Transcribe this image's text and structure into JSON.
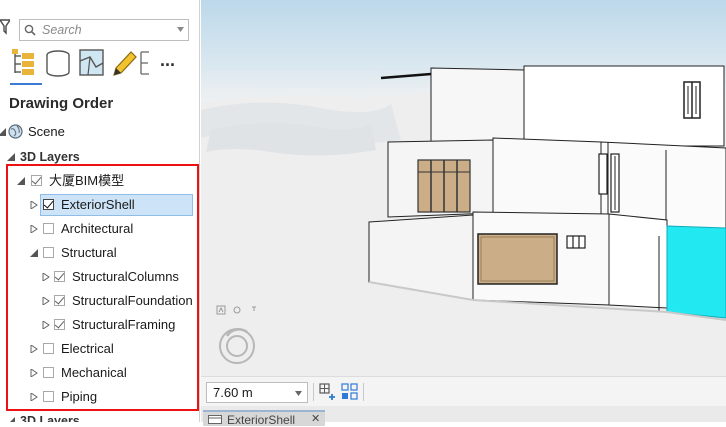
{
  "search": {
    "placeholder": "Search"
  },
  "contents": {
    "title": "Drawing Order",
    "toolbar_more_label": "..."
  },
  "tree": {
    "scene": "Scene",
    "group_3d_layers": "3D Layers",
    "bim_model": "大厦BIM模型",
    "exterior_shell": "ExteriorShell",
    "architectural": "Architectural",
    "structural": "Structural",
    "structural_columns": "StructuralColumns",
    "structural_foundation": "StructuralFoundation",
    "structural_framing": "StructuralFraming",
    "electrical": "Electrical",
    "mechanical": "Mechanical",
    "piping": "Piping",
    "group_3d_layers_2": "3D Layers"
  },
  "checked": {
    "bim_model": true,
    "exterior_shell": true,
    "architectural": false,
    "structural": false,
    "structural_columns": true,
    "structural_foundation": true,
    "structural_framing": true,
    "electrical": false,
    "mechanical": false,
    "piping": false
  },
  "selected_layer": "ExteriorShell",
  "scene_view": {
    "scale": "7.60 m",
    "tab_label": "ExteriorShell",
    "tab_close": "✕"
  },
  "colors": {
    "selection_bg": "#cde3f7",
    "highlight_box": "#e11111",
    "cyan_wall": "#22e8f2",
    "wood_panel": "#cbae87"
  },
  "icons": [
    "filter-icon",
    "search-icon",
    "list-by-drawing-order-icon",
    "list-by-data-source-icon",
    "list-by-selection-icon",
    "list-by-editing-icon",
    "list-by-labeling-icon",
    "more-icon",
    "globe-icon",
    "navigator-icon",
    "zoom-extent-icon",
    "select-features-icon",
    "scene-tab-icon"
  ]
}
